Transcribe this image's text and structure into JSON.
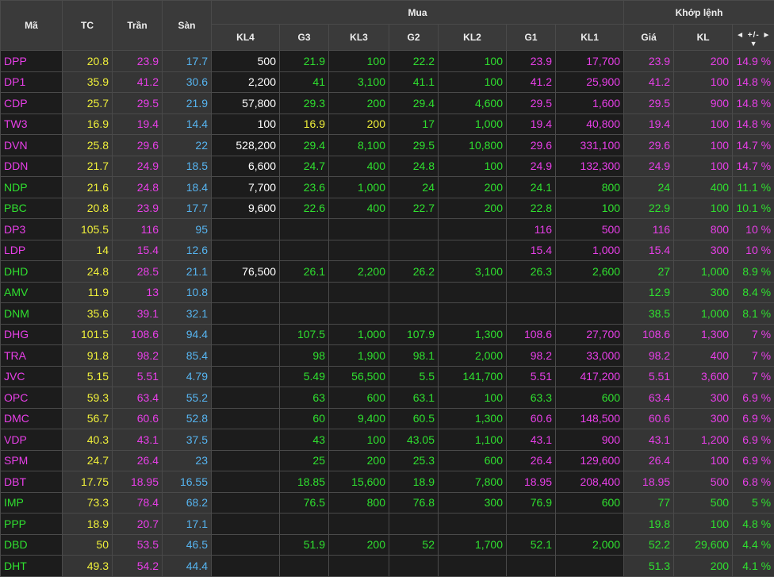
{
  "colors": {
    "ceiling": "#e83fe8",
    "floor": "#56b4f0",
    "reference": "#f0f03a",
    "up": "#2fe02f",
    "neutral": "#ffffff"
  },
  "header": {
    "symbol": "Mã",
    "ref": "TC",
    "ceiling": "Trần",
    "floor": "Sàn",
    "buy_group": "Mua",
    "match_group": "Khớp lệnh",
    "kl4": "KL4",
    "g3": "G3",
    "kl3": "KL3",
    "g2": "G2",
    "kl2": "KL2",
    "g1": "G1",
    "kl1": "KL1",
    "price": "Giá",
    "volume": "KL",
    "change": "+/-",
    "left_icon": "◄",
    "right_icon": "►",
    "down_icon": "▼"
  },
  "rows": [
    {
      "sym": "DPP",
      "tc": "20.8",
      "tran": "23.9",
      "san": "17.7",
      "kl4": "500",
      "kl4c": "neutral",
      "g3": "21.9",
      "g3c": "up",
      "kl3": "100",
      "kl3c": "up",
      "g2": "22.2",
      "g2c": "up",
      "kl2": "100",
      "kl2c": "up",
      "g1": "23.9",
      "g1c": "ceiling",
      "kl1": "17,700",
      "kl1c": "ceiling",
      "gia": "23.9",
      "kl": "200",
      "chg": "14.9 %",
      "mc": "ceiling"
    },
    {
      "sym": "DP1",
      "tc": "35.9",
      "tran": "41.2",
      "san": "30.6",
      "kl4": "2,200",
      "kl4c": "neutral",
      "g3": "41",
      "g3c": "up",
      "kl3": "3,100",
      "kl3c": "up",
      "g2": "41.1",
      "g2c": "up",
      "kl2": "100",
      "kl2c": "up",
      "g1": "41.2",
      "g1c": "ceiling",
      "kl1": "25,900",
      "kl1c": "ceiling",
      "gia": "41.2",
      "kl": "100",
      "chg": "14.8 %",
      "mc": "ceiling"
    },
    {
      "sym": "CDP",
      "tc": "25.7",
      "tran": "29.5",
      "san": "21.9",
      "kl4": "57,800",
      "kl4c": "neutral",
      "g3": "29.3",
      "g3c": "up",
      "kl3": "200",
      "kl3c": "up",
      "g2": "29.4",
      "g2c": "up",
      "kl2": "4,600",
      "kl2c": "up",
      "g1": "29.5",
      "g1c": "ceiling",
      "kl1": "1,600",
      "kl1c": "ceiling",
      "gia": "29.5",
      "kl": "900",
      "chg": "14.8 %",
      "mc": "ceiling"
    },
    {
      "sym": "TW3",
      "tc": "16.9",
      "tran": "19.4",
      "san": "14.4",
      "kl4": "100",
      "kl4c": "neutral",
      "g3": "16.9",
      "g3c": "reference",
      "kl3": "200",
      "kl3c": "reference",
      "g2": "17",
      "g2c": "up",
      "kl2": "1,000",
      "kl2c": "up",
      "g1": "19.4",
      "g1c": "ceiling",
      "kl1": "40,800",
      "kl1c": "ceiling",
      "gia": "19.4",
      "kl": "100",
      "chg": "14.8 %",
      "mc": "ceiling"
    },
    {
      "sym": "DVN",
      "tc": "25.8",
      "tran": "29.6",
      "san": "22",
      "kl4": "528,200",
      "kl4c": "neutral",
      "g3": "29.4",
      "g3c": "up",
      "kl3": "8,100",
      "kl3c": "up",
      "g2": "29.5",
      "g2c": "up",
      "kl2": "10,800",
      "kl2c": "up",
      "g1": "29.6",
      "g1c": "ceiling",
      "kl1": "331,100",
      "kl1c": "ceiling",
      "gia": "29.6",
      "kl": "100",
      "chg": "14.7 %",
      "mc": "ceiling"
    },
    {
      "sym": "DDN",
      "tc": "21.7",
      "tran": "24.9",
      "san": "18.5",
      "kl4": "6,600",
      "kl4c": "neutral",
      "g3": "24.7",
      "g3c": "up",
      "kl3": "400",
      "kl3c": "up",
      "g2": "24.8",
      "g2c": "up",
      "kl2": "100",
      "kl2c": "up",
      "g1": "24.9",
      "g1c": "ceiling",
      "kl1": "132,300",
      "kl1c": "ceiling",
      "gia": "24.9",
      "kl": "100",
      "chg": "14.7 %",
      "mc": "ceiling"
    },
    {
      "sym": "NDP",
      "tc": "21.6",
      "tran": "24.8",
      "san": "18.4",
      "kl4": "7,700",
      "kl4c": "neutral",
      "g3": "23.6",
      "g3c": "up",
      "kl3": "1,000",
      "kl3c": "up",
      "g2": "24",
      "g2c": "up",
      "kl2": "200",
      "kl2c": "up",
      "g1": "24.1",
      "g1c": "up",
      "kl1": "800",
      "kl1c": "up",
      "gia": "24",
      "kl": "400",
      "chg": "11.1 %",
      "mc": "up"
    },
    {
      "sym": "PBC",
      "tc": "20.8",
      "tran": "23.9",
      "san": "17.7",
      "kl4": "9,600",
      "kl4c": "neutral",
      "g3": "22.6",
      "g3c": "up",
      "kl3": "400",
      "kl3c": "up",
      "g2": "22.7",
      "g2c": "up",
      "kl2": "200",
      "kl2c": "up",
      "g1": "22.8",
      "g1c": "up",
      "kl1": "100",
      "kl1c": "up",
      "gia": "22.9",
      "kl": "100",
      "chg": "10.1 %",
      "mc": "up"
    },
    {
      "sym": "DP3",
      "tc": "105.5",
      "tran": "116",
      "san": "95",
      "kl4": "",
      "kl4c": "neutral",
      "g3": "",
      "g3c": "up",
      "kl3": "",
      "kl3c": "up",
      "g2": "",
      "g2c": "up",
      "kl2": "",
      "kl2c": "up",
      "g1": "116",
      "g1c": "ceiling",
      "kl1": "500",
      "kl1c": "ceiling",
      "gia": "116",
      "kl": "800",
      "chg": "10 %",
      "mc": "ceiling"
    },
    {
      "sym": "LDP",
      "tc": "14",
      "tran": "15.4",
      "san": "12.6",
      "kl4": "",
      "kl4c": "neutral",
      "g3": "",
      "g3c": "up",
      "kl3": "",
      "kl3c": "up",
      "g2": "",
      "g2c": "up",
      "kl2": "",
      "kl2c": "up",
      "g1": "15.4",
      "g1c": "ceiling",
      "kl1": "1,000",
      "kl1c": "ceiling",
      "gia": "15.4",
      "kl": "300",
      "chg": "10 %",
      "mc": "ceiling"
    },
    {
      "sym": "DHD",
      "tc": "24.8",
      "tran": "28.5",
      "san": "21.1",
      "kl4": "76,500",
      "kl4c": "neutral",
      "g3": "26.1",
      "g3c": "up",
      "kl3": "2,200",
      "kl3c": "up",
      "g2": "26.2",
      "g2c": "up",
      "kl2": "3,100",
      "kl2c": "up",
      "g1": "26.3",
      "g1c": "up",
      "kl1": "2,600",
      "kl1c": "up",
      "gia": "27",
      "kl": "1,000",
      "chg": "8.9 %",
      "mc": "up"
    },
    {
      "sym": "AMV",
      "tc": "11.9",
      "tran": "13",
      "san": "10.8",
      "kl4": "",
      "kl4c": "neutral",
      "g3": "",
      "g3c": "up",
      "kl3": "",
      "kl3c": "up",
      "g2": "",
      "g2c": "up",
      "kl2": "",
      "kl2c": "up",
      "g1": "",
      "g1c": "up",
      "kl1": "",
      "kl1c": "up",
      "gia": "12.9",
      "kl": "300",
      "chg": "8.4 %",
      "mc": "up"
    },
    {
      "sym": "DNM",
      "tc": "35.6",
      "tran": "39.1",
      "san": "32.1",
      "kl4": "",
      "kl4c": "neutral",
      "g3": "",
      "g3c": "up",
      "kl3": "",
      "kl3c": "up",
      "g2": "",
      "g2c": "up",
      "kl2": "",
      "kl2c": "up",
      "g1": "",
      "g1c": "up",
      "kl1": "",
      "kl1c": "up",
      "gia": "38.5",
      "kl": "1,000",
      "chg": "8.1 %",
      "mc": "up"
    },
    {
      "sym": "DHG",
      "tc": "101.5",
      "tran": "108.6",
      "san": "94.4",
      "kl4": "",
      "kl4c": "neutral",
      "g3": "107.5",
      "g3c": "up",
      "kl3": "1,000",
      "kl3c": "up",
      "g2": "107.9",
      "g2c": "up",
      "kl2": "1,300",
      "kl2c": "up",
      "g1": "108.6",
      "g1c": "ceiling",
      "kl1": "27,700",
      "kl1c": "ceiling",
      "gia": "108.6",
      "kl": "1,300",
      "chg": "7 %",
      "mc": "ceiling"
    },
    {
      "sym": "TRA",
      "tc": "91.8",
      "tran": "98.2",
      "san": "85.4",
      "kl4": "",
      "kl4c": "neutral",
      "g3": "98",
      "g3c": "up",
      "kl3": "1,900",
      "kl3c": "up",
      "g2": "98.1",
      "g2c": "up",
      "kl2": "2,000",
      "kl2c": "up",
      "g1": "98.2",
      "g1c": "ceiling",
      "kl1": "33,000",
      "kl1c": "ceiling",
      "gia": "98.2",
      "kl": "400",
      "chg": "7 %",
      "mc": "ceiling"
    },
    {
      "sym": "JVC",
      "tc": "5.15",
      "tran": "5.51",
      "san": "4.79",
      "kl4": "",
      "kl4c": "neutral",
      "g3": "5.49",
      "g3c": "up",
      "kl3": "56,500",
      "kl3c": "up",
      "g2": "5.5",
      "g2c": "up",
      "kl2": "141,700",
      "kl2c": "up",
      "g1": "5.51",
      "g1c": "ceiling",
      "kl1": "417,200",
      "kl1c": "ceiling",
      "gia": "5.51",
      "kl": "3,600",
      "chg": "7 %",
      "mc": "ceiling"
    },
    {
      "sym": "OPC",
      "tc": "59.3",
      "tran": "63.4",
      "san": "55.2",
      "kl4": "",
      "kl4c": "neutral",
      "g3": "63",
      "g3c": "up",
      "kl3": "600",
      "kl3c": "up",
      "g2": "63.1",
      "g2c": "up",
      "kl2": "100",
      "kl2c": "up",
      "g1": "63.3",
      "g1c": "up",
      "kl1": "600",
      "kl1c": "up",
      "gia": "63.4",
      "kl": "300",
      "chg": "6.9 %",
      "mc": "ceiling"
    },
    {
      "sym": "DMC",
      "tc": "56.7",
      "tran": "60.6",
      "san": "52.8",
      "kl4": "",
      "kl4c": "neutral",
      "g3": "60",
      "g3c": "up",
      "kl3": "9,400",
      "kl3c": "up",
      "g2": "60.5",
      "g2c": "up",
      "kl2": "1,300",
      "kl2c": "up",
      "g1": "60.6",
      "g1c": "ceiling",
      "kl1": "148,500",
      "kl1c": "ceiling",
      "gia": "60.6",
      "kl": "300",
      "chg": "6.9 %",
      "mc": "ceiling"
    },
    {
      "sym": "VDP",
      "tc": "40.3",
      "tran": "43.1",
      "san": "37.5",
      "kl4": "",
      "kl4c": "neutral",
      "g3": "43",
      "g3c": "up",
      "kl3": "100",
      "kl3c": "up",
      "g2": "43.05",
      "g2c": "up",
      "kl2": "1,100",
      "kl2c": "up",
      "g1": "43.1",
      "g1c": "ceiling",
      "kl1": "900",
      "kl1c": "ceiling",
      "gia": "43.1",
      "kl": "1,200",
      "chg": "6.9 %",
      "mc": "ceiling"
    },
    {
      "sym": "SPM",
      "tc": "24.7",
      "tran": "26.4",
      "san": "23",
      "kl4": "",
      "kl4c": "neutral",
      "g3": "25",
      "g3c": "up",
      "kl3": "200",
      "kl3c": "up",
      "g2": "25.3",
      "g2c": "up",
      "kl2": "600",
      "kl2c": "up",
      "g1": "26.4",
      "g1c": "ceiling",
      "kl1": "129,600",
      "kl1c": "ceiling",
      "gia": "26.4",
      "kl": "100",
      "chg": "6.9 %",
      "mc": "ceiling"
    },
    {
      "sym": "DBT",
      "tc": "17.75",
      "tran": "18.95",
      "san": "16.55",
      "kl4": "",
      "kl4c": "neutral",
      "g3": "18.85",
      "g3c": "up",
      "kl3": "15,600",
      "kl3c": "up",
      "g2": "18.9",
      "g2c": "up",
      "kl2": "7,800",
      "kl2c": "up",
      "g1": "18.95",
      "g1c": "ceiling",
      "kl1": "208,400",
      "kl1c": "ceiling",
      "gia": "18.95",
      "kl": "500",
      "chg": "6.8 %",
      "mc": "ceiling"
    },
    {
      "sym": "IMP",
      "tc": "73.3",
      "tran": "78.4",
      "san": "68.2",
      "kl4": "",
      "kl4c": "neutral",
      "g3": "76.5",
      "g3c": "up",
      "kl3": "800",
      "kl3c": "up",
      "g2": "76.8",
      "g2c": "up",
      "kl2": "300",
      "kl2c": "up",
      "g1": "76.9",
      "g1c": "up",
      "kl1": "600",
      "kl1c": "up",
      "gia": "77",
      "kl": "500",
      "chg": "5 %",
      "mc": "up"
    },
    {
      "sym": "PPP",
      "tc": "18.9",
      "tran": "20.7",
      "san": "17.1",
      "kl4": "",
      "kl4c": "neutral",
      "g3": "",
      "g3c": "up",
      "kl3": "",
      "kl3c": "up",
      "g2": "",
      "g2c": "up",
      "kl2": "",
      "kl2c": "up",
      "g1": "",
      "g1c": "up",
      "kl1": "",
      "kl1c": "up",
      "gia": "19.8",
      "kl": "100",
      "chg": "4.8 %",
      "mc": "up"
    },
    {
      "sym": "DBD",
      "tc": "50",
      "tran": "53.5",
      "san": "46.5",
      "kl4": "",
      "kl4c": "neutral",
      "g3": "51.9",
      "g3c": "up",
      "kl3": "200",
      "kl3c": "up",
      "g2": "52",
      "g2c": "up",
      "kl2": "1,700",
      "kl2c": "up",
      "g1": "52.1",
      "g1c": "up",
      "kl1": "2,000",
      "kl1c": "up",
      "gia": "52.2",
      "kl": "29,600",
      "chg": "4.4 %",
      "mc": "up"
    },
    {
      "sym": "DHT",
      "tc": "49.3",
      "tran": "54.2",
      "san": "44.4",
      "kl4": "",
      "kl4c": "neutral",
      "g3": "",
      "g3c": "up",
      "kl3": "",
      "kl3c": "up",
      "g2": "",
      "g2c": "up",
      "kl2": "",
      "kl2c": "up",
      "g1": "",
      "g1c": "up",
      "kl1": "",
      "kl1c": "up",
      "gia": "51.3",
      "kl": "200",
      "chg": "4.1 %",
      "mc": "up"
    }
  ]
}
